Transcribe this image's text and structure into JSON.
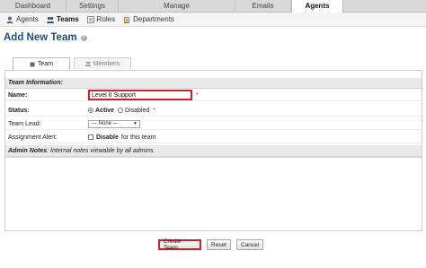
{
  "top_tabs": [
    {
      "label": "Dashboard",
      "active": false
    },
    {
      "label": "Settings",
      "active": false
    },
    {
      "label": "Manage",
      "active": false
    },
    {
      "label": "Emails",
      "active": false
    },
    {
      "label": "Agents",
      "active": true
    }
  ],
  "sub_nav": [
    {
      "label": "Agents",
      "icon": "agent-icon",
      "active": false
    },
    {
      "label": "Teams",
      "icon": "teams-icon",
      "active": true
    },
    {
      "label": "Roles",
      "icon": "roles-icon",
      "active": false
    },
    {
      "label": "Departments",
      "icon": "departments-icon",
      "active": false
    }
  ],
  "page": {
    "title": "Add New Team",
    "help_glyph": "?"
  },
  "form_tabs": [
    {
      "label": "Team",
      "icon": "team-icon",
      "active": true
    },
    {
      "label": "Members",
      "icon": "members-icon",
      "active": false
    }
  ],
  "form": {
    "section_title": "Team Information",
    "name": {
      "label": "Name:",
      "value": "Level II Support",
      "required_mark": "*"
    },
    "status": {
      "label": "Status:",
      "options": [
        "Active",
        "Disabled"
      ],
      "selected": "Active",
      "required_mark": "*"
    },
    "team_lead": {
      "label": "Team Lead:",
      "value": "— None —"
    },
    "assignment_alert": {
      "label": "Assignment Alert:",
      "checkbox_label": "Disable",
      "suffix": "for this team"
    },
    "notes_section_title": "Admin Notes",
    "notes_section_desc": ": Internal notes viewable by all admins."
  },
  "buttons": {
    "create": "Create Team",
    "reset": "Reset",
    "cancel": "Cancel"
  },
  "colors": {
    "title_blue": "#184e81",
    "highlight_red": "#d0202a"
  }
}
